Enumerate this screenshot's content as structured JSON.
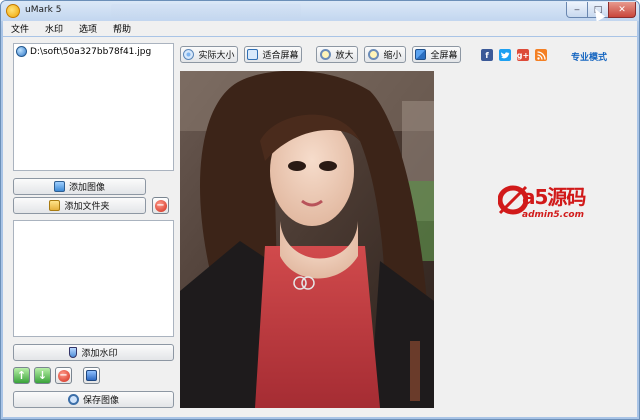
{
  "window": {
    "title": "uMark 5"
  },
  "menu": [
    "文件",
    "水印",
    "选项",
    "帮助"
  ],
  "left_panel": {
    "files": [
      "D:\\soft\\50a327bb78f41.jpg"
    ],
    "add_image_label": "添加图像",
    "add_folder_label": "添加文件夹",
    "add_watermark_label": "添加水印",
    "save_image_label": "保存图像"
  },
  "toolbar": {
    "actual_size_label": "实际大小",
    "fit_screen_label": "适合屏幕",
    "zoom_in_label": "放大",
    "zoom_out_label": "缩小",
    "fullscreen_label": "全屏幕",
    "pro_mode_label": "专业模式"
  },
  "social": {
    "facebook": "f",
    "google_plus": "g+"
  },
  "logo": {
    "main": "a5源码",
    "sub": "admin5.com"
  },
  "colors": {
    "titlebar": "#c2d6ef",
    "link": "#1565c0",
    "logo_red": "#d11a1a"
  }
}
